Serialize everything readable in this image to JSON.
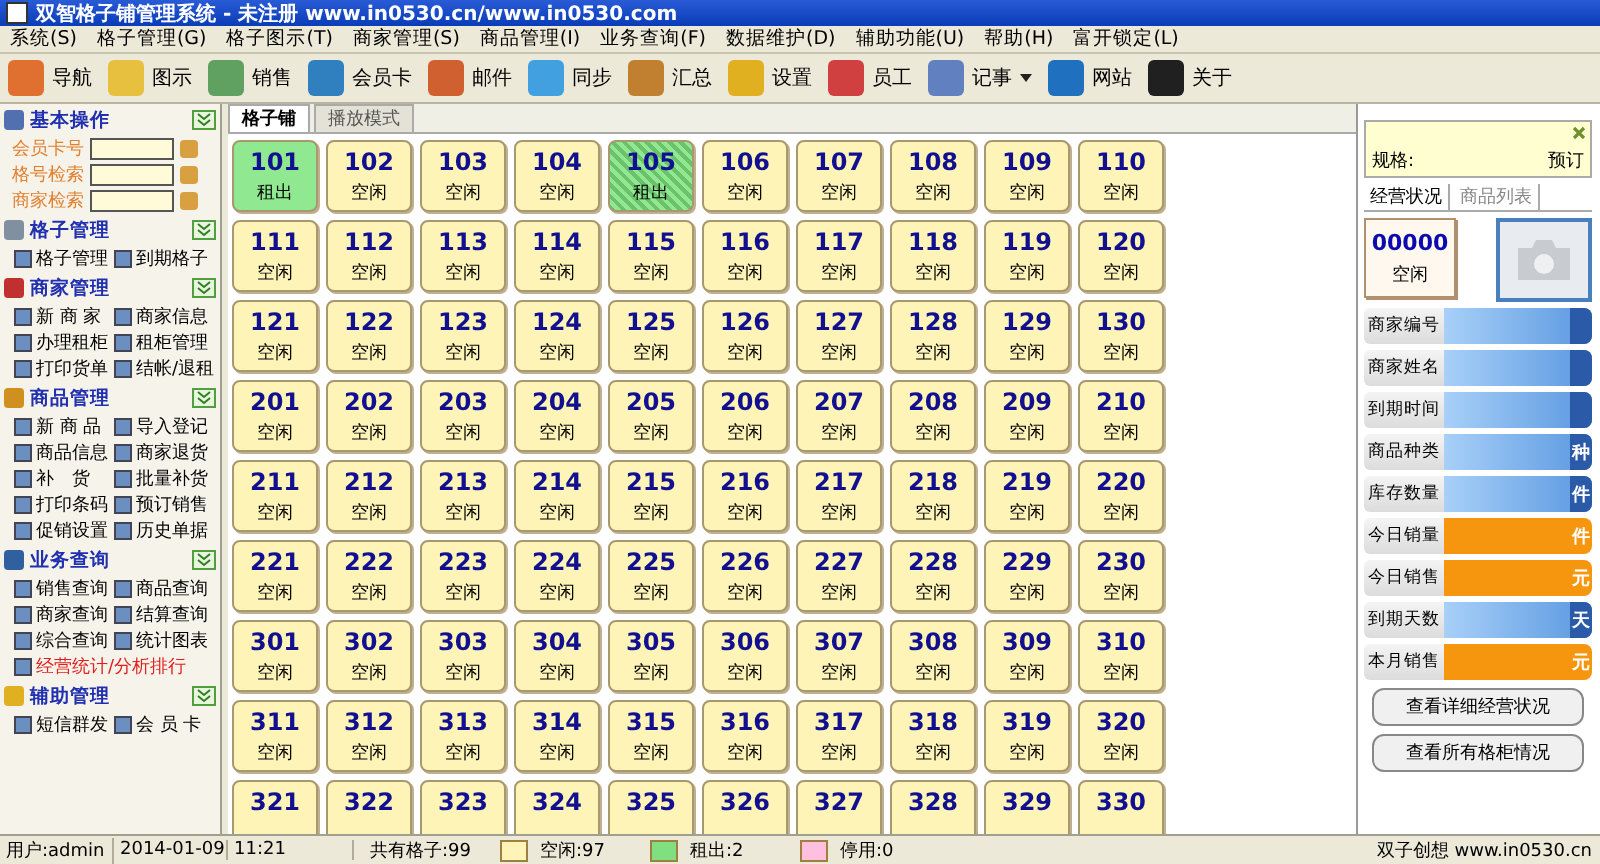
{
  "window": {
    "title": "双智格子铺管理系统 - 未注册 www.in0530.cn/www.in0530.com"
  },
  "menu": [
    "系统(S)",
    "格子管理(G)",
    "格子图示(T)",
    "商家管理(S)",
    "商品管理(I)",
    "业务查询(F)",
    "数据维护(D)",
    "辅助功能(U)",
    "帮助(H)",
    "富开锁定(L)"
  ],
  "toolbar": [
    {
      "label": "导航",
      "dropdown": false
    },
    {
      "label": "图示",
      "dropdown": false
    },
    {
      "label": "销售",
      "dropdown": false
    },
    {
      "label": "会员卡",
      "dropdown": false
    },
    {
      "label": "邮件",
      "dropdown": false
    },
    {
      "label": "同步",
      "dropdown": false
    },
    {
      "label": "汇总",
      "dropdown": false
    },
    {
      "label": "设置",
      "dropdown": false
    },
    {
      "label": "员工",
      "dropdown": false
    },
    {
      "label": "记事",
      "dropdown": true
    },
    {
      "label": "网站",
      "dropdown": false
    },
    {
      "label": "关于",
      "dropdown": false
    }
  ],
  "sidebar": {
    "sections": [
      {
        "title": "基本操作",
        "kind": "fields",
        "items": [
          {
            "label": "会员卡号",
            "emphasized": false
          },
          {
            "label": "格号检索",
            "emphasized": false
          },
          {
            "label": "商家检索",
            "emphasized": false
          }
        ]
      },
      {
        "title": "格子管理",
        "kind": "links",
        "items": [
          {
            "label": "格子管理",
            "emphasized": false
          },
          {
            "label": "到期格子",
            "emphasized": false
          }
        ]
      },
      {
        "title": "商家管理",
        "kind": "links",
        "items": [
          {
            "label": "新 商 家",
            "emphasized": false
          },
          {
            "label": "商家信息",
            "emphasized": false
          },
          {
            "label": "办理租柜",
            "emphasized": false
          },
          {
            "label": "租柜管理",
            "emphasized": false
          },
          {
            "label": "打印货单",
            "emphasized": false
          },
          {
            "label": "结帐/退租",
            "emphasized": false
          }
        ]
      },
      {
        "title": "商品管理",
        "kind": "links",
        "items": [
          {
            "label": "新 商 品",
            "emphasized": false
          },
          {
            "label": "导入登记",
            "emphasized": false
          },
          {
            "label": "商品信息",
            "emphasized": false
          },
          {
            "label": "商家退货",
            "emphasized": false
          },
          {
            "label": "补　货",
            "emphasized": false
          },
          {
            "label": "批量补货",
            "emphasized": false
          },
          {
            "label": "打印条码",
            "emphasized": false
          },
          {
            "label": "预订销售",
            "emphasized": false
          },
          {
            "label": "促销设置",
            "emphasized": false
          },
          {
            "label": "历史单据",
            "emphasized": false
          }
        ]
      },
      {
        "title": "业务查询",
        "kind": "links",
        "items": [
          {
            "label": "销售查询",
            "emphasized": false
          },
          {
            "label": "商品查询",
            "emphasized": false
          },
          {
            "label": "商家查询",
            "emphasized": false
          },
          {
            "label": "结算查询",
            "emphasized": false
          },
          {
            "label": "综合查询",
            "emphasized": false
          },
          {
            "label": "统计图表",
            "emphasized": false
          },
          {
            "label": "经营统计/分析排行",
            "emphasized": true
          }
        ]
      },
      {
        "title": "辅助管理",
        "kind": "links",
        "items": [
          {
            "label": "短信群发",
            "emphasized": false
          },
          {
            "label": "会 员 卡",
            "emphasized": false
          }
        ]
      }
    ]
  },
  "grid": {
    "tabs": [
      {
        "label": "格子铺",
        "selected": true
      },
      {
        "label": "播放模式",
        "selected": false
      }
    ],
    "cells": [
      {
        "number": "101",
        "status": "租出",
        "kind": "rented",
        "selected": false
      },
      {
        "number": "102",
        "status": "空闲",
        "kind": "free",
        "selected": false
      },
      {
        "number": "103",
        "status": "空闲",
        "kind": "free",
        "selected": false
      },
      {
        "number": "104",
        "status": "空闲",
        "kind": "free",
        "selected": false
      },
      {
        "number": "105",
        "status": "租出",
        "kind": "rented",
        "selected": true
      },
      {
        "number": "106",
        "status": "空闲",
        "kind": "free",
        "selected": false
      },
      {
        "number": "107",
        "status": "空闲",
        "kind": "free",
        "selected": false
      },
      {
        "number": "108",
        "status": "空闲",
        "kind": "free",
        "selected": false
      },
      {
        "number": "109",
        "status": "空闲",
        "kind": "free",
        "selected": false
      },
      {
        "number": "110",
        "status": "空闲",
        "kind": "free",
        "selected": false
      },
      {
        "number": "111",
        "status": "空闲",
        "kind": "free",
        "selected": false
      },
      {
        "number": "112",
        "status": "空闲",
        "kind": "free",
        "selected": false
      },
      {
        "number": "113",
        "status": "空闲",
        "kind": "free",
        "selected": false
      },
      {
        "number": "114",
        "status": "空闲",
        "kind": "free",
        "selected": false
      },
      {
        "number": "115",
        "status": "空闲",
        "kind": "free",
        "selected": false
      },
      {
        "number": "116",
        "status": "空闲",
        "kind": "free",
        "selected": false
      },
      {
        "number": "117",
        "status": "空闲",
        "kind": "free",
        "selected": false
      },
      {
        "number": "118",
        "status": "空闲",
        "kind": "free",
        "selected": false
      },
      {
        "number": "119",
        "status": "空闲",
        "kind": "free",
        "selected": false
      },
      {
        "number": "120",
        "status": "空闲",
        "kind": "free",
        "selected": false
      },
      {
        "number": "121",
        "status": "空闲",
        "kind": "free",
        "selected": false
      },
      {
        "number": "122",
        "status": "空闲",
        "kind": "free",
        "selected": false
      },
      {
        "number": "123",
        "status": "空闲",
        "kind": "free",
        "selected": false
      },
      {
        "number": "124",
        "status": "空闲",
        "kind": "free",
        "selected": false
      },
      {
        "number": "125",
        "status": "空闲",
        "kind": "free",
        "selected": false
      },
      {
        "number": "126",
        "status": "空闲",
        "kind": "free",
        "selected": false
      },
      {
        "number": "127",
        "status": "空闲",
        "kind": "free",
        "selected": false
      },
      {
        "number": "128",
        "status": "空闲",
        "kind": "free",
        "selected": false
      },
      {
        "number": "129",
        "status": "空闲",
        "kind": "free",
        "selected": false
      },
      {
        "number": "130",
        "status": "空闲",
        "kind": "free",
        "selected": false
      },
      {
        "number": "201",
        "status": "空闲",
        "kind": "free",
        "selected": false
      },
      {
        "number": "202",
        "status": "空闲",
        "kind": "free",
        "selected": false
      },
      {
        "number": "203",
        "status": "空闲",
        "kind": "free",
        "selected": false
      },
      {
        "number": "204",
        "status": "空闲",
        "kind": "free",
        "selected": false
      },
      {
        "number": "205",
        "status": "空闲",
        "kind": "free",
        "selected": false
      },
      {
        "number": "206",
        "status": "空闲",
        "kind": "free",
        "selected": false
      },
      {
        "number": "207",
        "status": "空闲",
        "kind": "free",
        "selected": false
      },
      {
        "number": "208",
        "status": "空闲",
        "kind": "free",
        "selected": false
      },
      {
        "number": "209",
        "status": "空闲",
        "kind": "free",
        "selected": false
      },
      {
        "number": "210",
        "status": "空闲",
        "kind": "free",
        "selected": false
      },
      {
        "number": "211",
        "status": "空闲",
        "kind": "free",
        "selected": false
      },
      {
        "number": "212",
        "status": "空闲",
        "kind": "free",
        "selected": false
      },
      {
        "number": "213",
        "status": "空闲",
        "kind": "free",
        "selected": false
      },
      {
        "number": "214",
        "status": "空闲",
        "kind": "free",
        "selected": false
      },
      {
        "number": "215",
        "status": "空闲",
        "kind": "free",
        "selected": false
      },
      {
        "number": "216",
        "status": "空闲",
        "kind": "free",
        "selected": false
      },
      {
        "number": "217",
        "status": "空闲",
        "kind": "free",
        "selected": false
      },
      {
        "number": "218",
        "status": "空闲",
        "kind": "free",
        "selected": false
      },
      {
        "number": "219",
        "status": "空闲",
        "kind": "free",
        "selected": false
      },
      {
        "number": "220",
        "status": "空闲",
        "kind": "free",
        "selected": false
      },
      {
        "number": "221",
        "status": "空闲",
        "kind": "free",
        "selected": false
      },
      {
        "number": "222",
        "status": "空闲",
        "kind": "free",
        "selected": false
      },
      {
        "number": "223",
        "status": "空闲",
        "kind": "free",
        "selected": false
      },
      {
        "number": "224",
        "status": "空闲",
        "kind": "free",
        "selected": false
      },
      {
        "number": "225",
        "status": "空闲",
        "kind": "free",
        "selected": false
      },
      {
        "number": "226",
        "status": "空闲",
        "kind": "free",
        "selected": false
      },
      {
        "number": "227",
        "status": "空闲",
        "kind": "free",
        "selected": false
      },
      {
        "number": "228",
        "status": "空闲",
        "kind": "free",
        "selected": false
      },
      {
        "number": "229",
        "status": "空闲",
        "kind": "free",
        "selected": false
      },
      {
        "number": "230",
        "status": "空闲",
        "kind": "free",
        "selected": false
      },
      {
        "number": "301",
        "status": "空闲",
        "kind": "free",
        "selected": false
      },
      {
        "number": "302",
        "status": "空闲",
        "kind": "free",
        "selected": false
      },
      {
        "number": "303",
        "status": "空闲",
        "kind": "free",
        "selected": false
      },
      {
        "number": "304",
        "status": "空闲",
        "kind": "free",
        "selected": false
      },
      {
        "number": "305",
        "status": "空闲",
        "kind": "free",
        "selected": false
      },
      {
        "number": "306",
        "status": "空闲",
        "kind": "free",
        "selected": false
      },
      {
        "number": "307",
        "status": "空闲",
        "kind": "free",
        "selected": false
      },
      {
        "number": "308",
        "status": "空闲",
        "kind": "free",
        "selected": false
      },
      {
        "number": "309",
        "status": "空闲",
        "kind": "free",
        "selected": false
      },
      {
        "number": "310",
        "status": "空闲",
        "kind": "free",
        "selected": false
      },
      {
        "number": "311",
        "status": "空闲",
        "kind": "free",
        "selected": false
      },
      {
        "number": "312",
        "status": "空闲",
        "kind": "free",
        "selected": false
      },
      {
        "number": "313",
        "status": "空闲",
        "kind": "free",
        "selected": false
      },
      {
        "number": "314",
        "status": "空闲",
        "kind": "free",
        "selected": false
      },
      {
        "number": "315",
        "status": "空闲",
        "kind": "free",
        "selected": false
      },
      {
        "number": "316",
        "status": "空闲",
        "kind": "free",
        "selected": false
      },
      {
        "number": "317",
        "status": "空闲",
        "kind": "free",
        "selected": false
      },
      {
        "number": "318",
        "status": "空闲",
        "kind": "free",
        "selected": false
      },
      {
        "number": "319",
        "status": "空闲",
        "kind": "free",
        "selected": false
      },
      {
        "number": "320",
        "status": "空闲",
        "kind": "free",
        "selected": false
      },
      {
        "number": "321",
        "kind": "free",
        "selected": false
      },
      {
        "number": "322",
        "kind": "free",
        "selected": false
      },
      {
        "number": "323",
        "kind": "free",
        "selected": false
      },
      {
        "number": "324",
        "kind": "free",
        "selected": false
      },
      {
        "number": "325",
        "kind": "free",
        "selected": false
      },
      {
        "number": "326",
        "kind": "free",
        "selected": false
      },
      {
        "number": "327",
        "kind": "free",
        "selected": false
      },
      {
        "number": "328",
        "kind": "free",
        "selected": false
      },
      {
        "number": "329",
        "kind": "free",
        "selected": false
      },
      {
        "number": "330",
        "kind": "free",
        "selected": false
      }
    ]
  },
  "detail": {
    "spec_label": "规格:",
    "reserve_label": "预订",
    "tabs": [
      {
        "label": "经营状况",
        "selected": true
      },
      {
        "label": "商品列表",
        "selected": false
      }
    ],
    "card": {
      "code": "00000",
      "status": "空闲"
    },
    "fields": [
      {
        "label": "商家编号",
        "kind": "blue"
      },
      {
        "label": "商家姓名",
        "kind": "blue"
      },
      {
        "label": "到期时间",
        "kind": "blue"
      },
      {
        "label": "商品种类",
        "kind": "blue",
        "unit": "种"
      },
      {
        "label": "库存数量",
        "kind": "blue",
        "unit": "件"
      },
      {
        "label": "今日销量",
        "kind": "orange",
        "unit": "件"
      },
      {
        "label": "今日销售",
        "kind": "orange",
        "unit": "元"
      },
      {
        "label": "到期天数",
        "kind": "blue",
        "unit": "天"
      },
      {
        "label": "本月销售",
        "kind": "orange",
        "unit": "元"
      }
    ],
    "buttons": [
      "查看详细经营状况",
      "查看所有格柜情况"
    ]
  },
  "status_bar": {
    "user": "用户:admin",
    "date": "2014-01-09",
    "time": "11:21",
    "total": "共有格子:99",
    "legend": [
      {
        "label": "空闲:97",
        "color": "#fff4b8"
      },
      {
        "label": "租出:2",
        "color": "#80e080"
      },
      {
        "label": "停用:0",
        "color": "#ffc0e0"
      }
    ],
    "credit": "双子创想 www.in0530.cn"
  }
}
